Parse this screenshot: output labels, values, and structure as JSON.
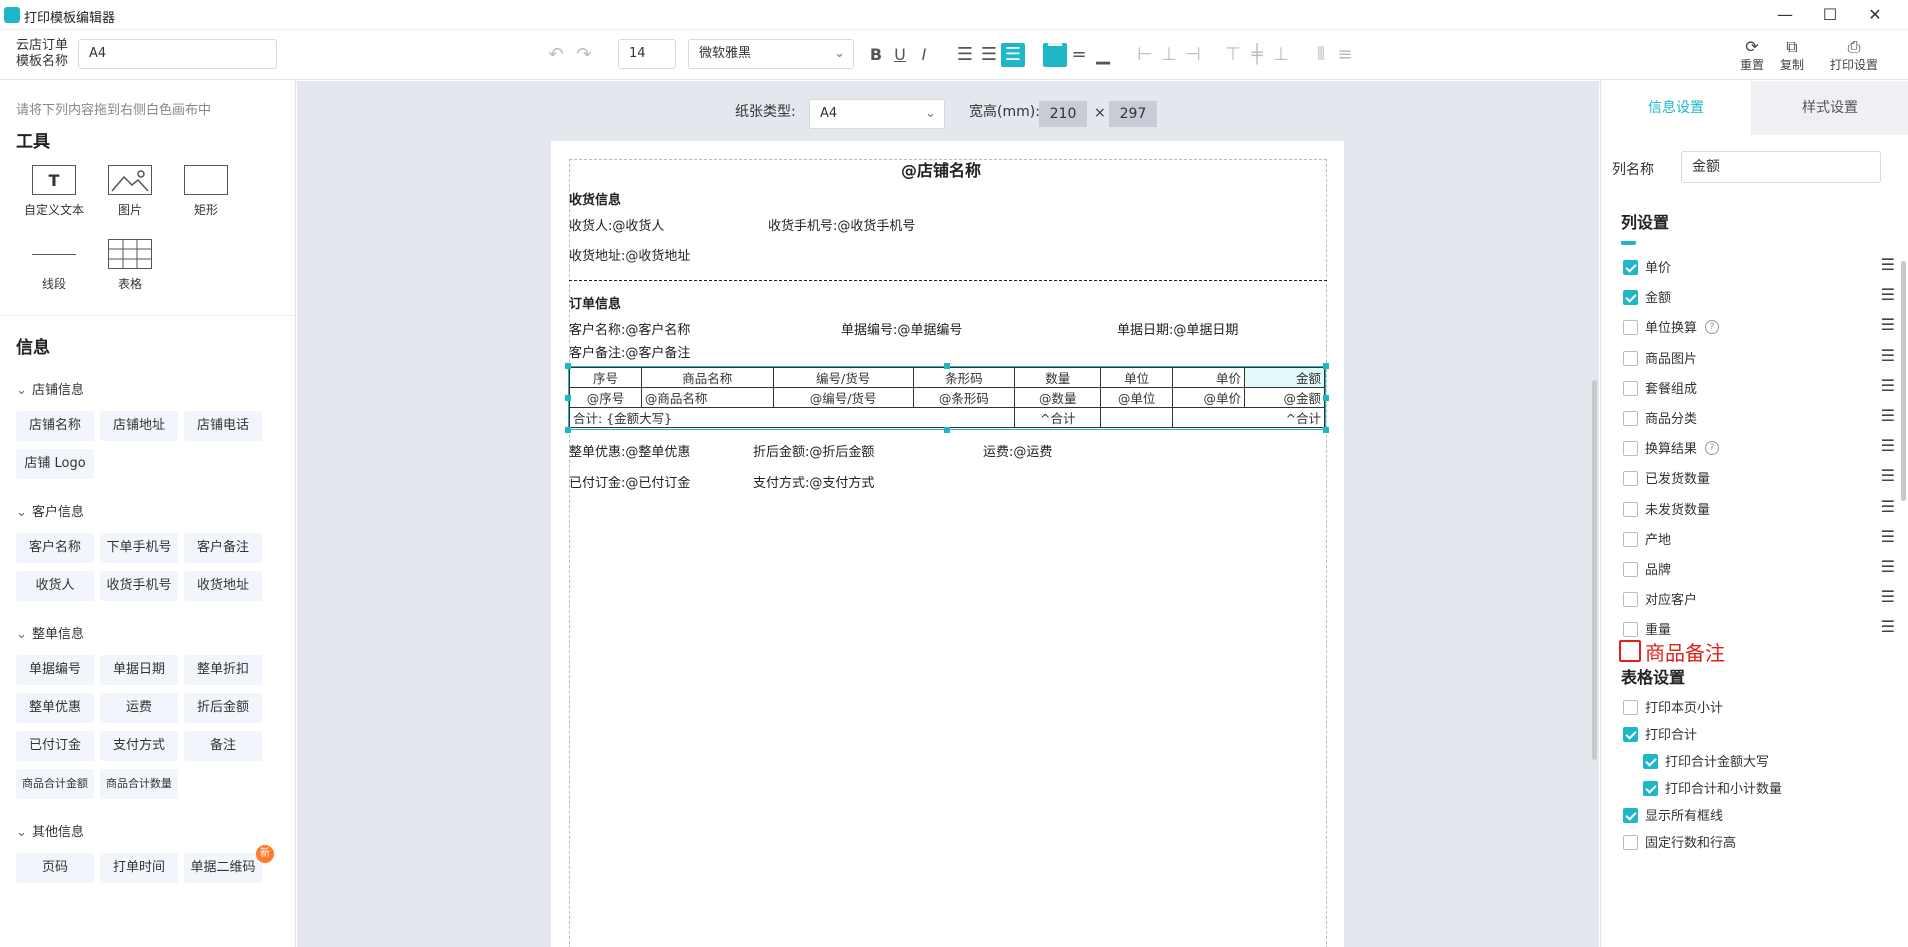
{
  "app": {
    "title": "打印模板编辑器"
  },
  "toolbar": {
    "template_label_line1": "云店订单",
    "template_label_line2": "模板名称",
    "template_name": "A4",
    "font_size": "14",
    "font_family": "微软雅黑",
    "reset_label": "重置",
    "copy_label": "复制",
    "print_settings_label": "打印设置"
  },
  "left": {
    "hint": "请将下列内容拖到右侧白色画布中",
    "tools_title": "工具",
    "tools": [
      "自定义文本",
      "图片",
      "矩形",
      "线段",
      "表格"
    ],
    "info_title": "信息",
    "groups": [
      {
        "name": "店铺信息",
        "items": [
          "店铺名称",
          "店铺地址",
          "店铺电话",
          "店铺 Logo"
        ]
      },
      {
        "name": "客户信息",
        "items": [
          "客户名称",
          "下单手机号",
          "客户备注",
          "收货人",
          "收货手机号",
          "收货地址"
        ]
      },
      {
        "name": "整单信息",
        "items": [
          "单据编号",
          "单据日期",
          "整单折扣",
          "整单优惠",
          "运费",
          "折后金额",
          "已付订金",
          "支付方式",
          "备注",
          "商品合计金额",
          "商品合计数量"
        ]
      },
      {
        "name": "其他信息",
        "items": [
          "页码",
          "打单时间",
          "单据二维码"
        ]
      }
    ],
    "new_badge": "新"
  },
  "canvas": {
    "paper_type_label": "纸张类型:",
    "paper_type": "A4",
    "size_label": "宽高(mm):",
    "width": "210",
    "times": "×",
    "height": "297"
  },
  "paper": {
    "shop_name": "@店铺名称",
    "receive_title": "收货信息",
    "receiver": "收货人:@收货人",
    "receiver_phone": "收货手机号:@收货手机号",
    "receiver_addr": "收货地址:@收货地址",
    "order_title": "订单信息",
    "customer_name": "客户名称:@客户名称",
    "doc_no": "单据编号:@单据编号",
    "doc_date": "单据日期:@单据日期",
    "customer_note": "客户备注:@客户备注",
    "table_headers": [
      "序号",
      "商品名称",
      "编号/货号",
      "条形码",
      "数量",
      "单位",
      "单价",
      "金额"
    ],
    "table_row": [
      "@序号",
      "@商品名称",
      "@编号/货号",
      "@条形码",
      "@数量",
      "@单位",
      "@单价",
      "@金额"
    ],
    "total_label": "合计: {金额大写}",
    "total_qty": "^合计",
    "total_amount": "^合计",
    "discount": "整单优惠:@整单优惠",
    "after_discount": "折后金额:@折后金额",
    "freight": "运费:@运费",
    "deposit": "已付订金:@已付订金",
    "pay_method": "支付方式:@支付方式"
  },
  "right": {
    "tab_info": "信息设置",
    "tab_style": "样式设置",
    "col_name_label": "列名称",
    "col_name_value": "金额",
    "col_settings_title": "列设置",
    "columns": [
      {
        "label": "单价",
        "checked": true
      },
      {
        "label": "金额",
        "checked": true
      },
      {
        "label": "单位换算",
        "checked": false,
        "help": true
      },
      {
        "label": "商品图片",
        "checked": false
      },
      {
        "label": "套餐组成",
        "checked": false
      },
      {
        "label": "商品分类",
        "checked": false
      },
      {
        "label": "换算结果",
        "checked": false,
        "help": true
      },
      {
        "label": "已发货数量",
        "checked": false
      },
      {
        "label": "未发货数量",
        "checked": false
      },
      {
        "label": "产地",
        "checked": false
      },
      {
        "label": "品牌",
        "checked": false
      },
      {
        "label": "对应客户",
        "checked": false
      },
      {
        "label": "重量",
        "checked": false
      }
    ],
    "annotation": "商品备注",
    "table_settings_title": "表格设置",
    "table_options": [
      {
        "label": "打印本页小计",
        "checked": false,
        "indent": false
      },
      {
        "label": "打印合计",
        "checked": true,
        "indent": false
      },
      {
        "label": "打印合计金额大写",
        "checked": true,
        "indent": true
      },
      {
        "label": "打印合计和小计数量",
        "checked": true,
        "indent": true
      },
      {
        "label": "显示所有框线",
        "checked": true,
        "indent": false
      },
      {
        "label": "固定行数和行高",
        "checked": false,
        "indent": false
      }
    ],
    "accent": "#1fb6c8",
    "annotation_color": "#e0201b"
  }
}
